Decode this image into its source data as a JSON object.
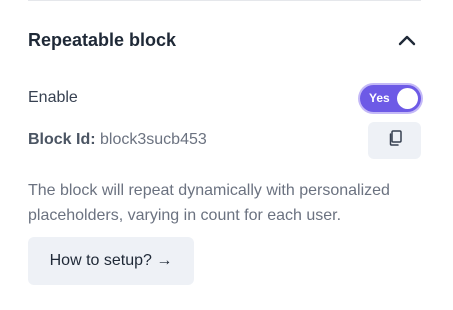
{
  "section": {
    "title": "Repeatable block",
    "expanded_icon": "chevron-up-icon"
  },
  "enable": {
    "label": "Enable",
    "toggle_text": "Yes",
    "toggle_on": true,
    "toggle_color": "#6d5ae6"
  },
  "block_id": {
    "label": "Block Id:",
    "value": "block3sucb453",
    "copy_icon": "copy-icon"
  },
  "description": "The block will repeat dynamically with personalized placeholders, varying in count for each user.",
  "setup_button": {
    "label": "How to setup? →"
  }
}
